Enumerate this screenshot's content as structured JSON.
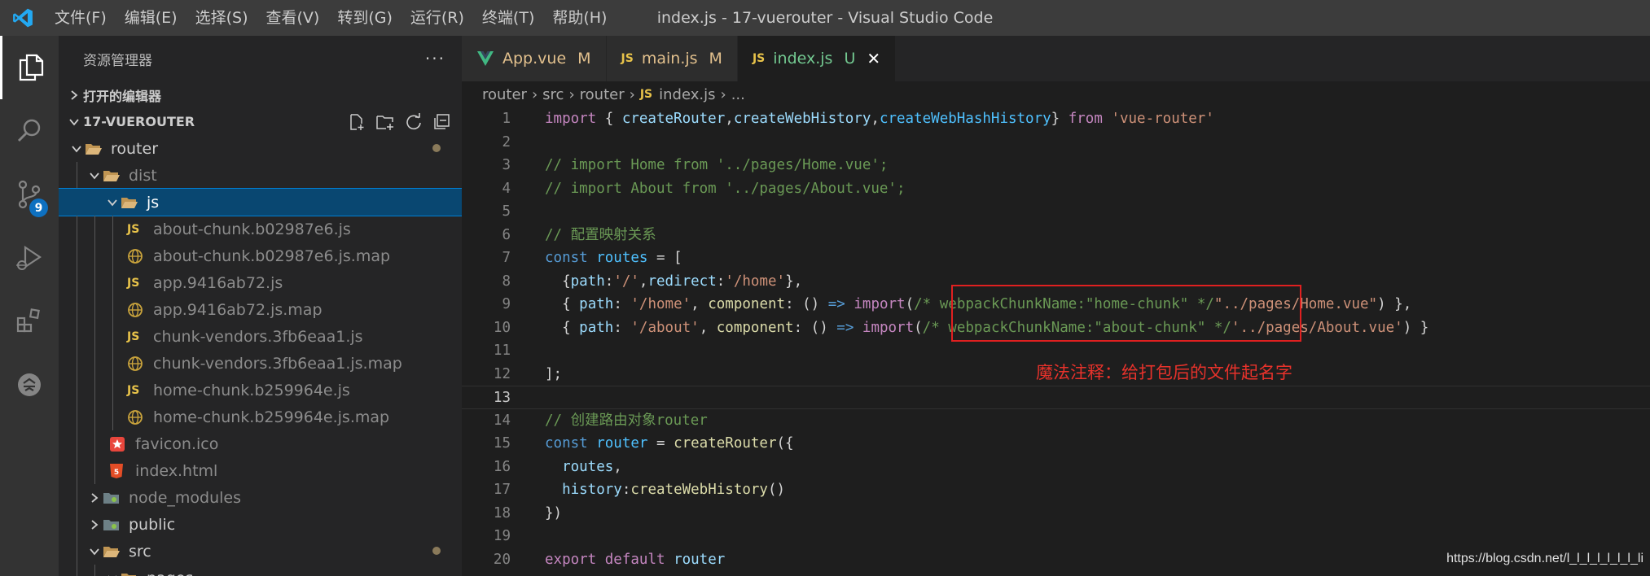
{
  "titlebar": {
    "menu": [
      "文件(F)",
      "编辑(E)",
      "选择(S)",
      "查看(V)",
      "转到(G)",
      "运行(R)",
      "终端(T)",
      "帮助(H)"
    ],
    "window_title": "index.js - 17-vuerouter - Visual Studio Code"
  },
  "activitybar": {
    "items": [
      {
        "icon": "explorer-icon"
      },
      {
        "icon": "search-icon"
      },
      {
        "icon": "source-control-icon",
        "badge": "9"
      },
      {
        "icon": "run-debug-icon"
      },
      {
        "icon": "extensions-icon"
      },
      {
        "icon": "remote-icon"
      }
    ]
  },
  "sidebar": {
    "title": "资源管理器",
    "more": "···",
    "open_editors": "打开的编辑器",
    "project": "17-VUEROUTER",
    "tree": [
      {
        "label": "router",
        "type": "folder-open",
        "depth": 0,
        "modified": true
      },
      {
        "label": "dist",
        "type": "folder-open",
        "depth": 1,
        "dim": true
      },
      {
        "label": "js",
        "type": "folder-open",
        "depth": 2,
        "selected": true
      },
      {
        "label": "about-chunk.b02987e6.js",
        "type": "js",
        "depth": 3,
        "dim": true
      },
      {
        "label": "about-chunk.b02987e6.js.map",
        "type": "map",
        "depth": 3,
        "dim": true
      },
      {
        "label": "app.9416ab72.js",
        "type": "js",
        "depth": 3,
        "dim": true
      },
      {
        "label": "app.9416ab72.js.map",
        "type": "map",
        "depth": 3,
        "dim": true
      },
      {
        "label": "chunk-vendors.3fb6eaa1.js",
        "type": "js",
        "depth": 3,
        "dim": true
      },
      {
        "label": "chunk-vendors.3fb6eaa1.js.map",
        "type": "map",
        "depth": 3,
        "dim": true
      },
      {
        "label": "home-chunk.b259964e.js",
        "type": "js",
        "depth": 3,
        "dim": true
      },
      {
        "label": "home-chunk.b259964e.js.map",
        "type": "map",
        "depth": 3,
        "dim": true
      },
      {
        "label": "favicon.ico",
        "type": "star",
        "depth": 2,
        "dim": true
      },
      {
        "label": "index.html",
        "type": "html",
        "depth": 2,
        "dim": true
      },
      {
        "label": "node_modules",
        "type": "folder-closed",
        "depth": 1,
        "dim": true
      },
      {
        "label": "public",
        "type": "folder-closed",
        "depth": 1
      },
      {
        "label": "src",
        "type": "folder-open",
        "depth": 1,
        "modified": true
      },
      {
        "label": "pages",
        "type": "folder-open",
        "depth": 2
      }
    ]
  },
  "tabs": [
    {
      "name": "App.vue",
      "icon": "vue",
      "status": "M",
      "status_color": "#e2c08d",
      "name_color": "#e2c08d"
    },
    {
      "name": "main.js",
      "icon": "js",
      "status": "M",
      "status_color": "#e2c08d",
      "name_color": "#e2c08d"
    },
    {
      "name": "index.js",
      "icon": "js",
      "status": "U",
      "status_color": "#73c991",
      "name_color": "#73c991",
      "active": true
    }
  ],
  "breadcrumb": {
    "parts": [
      "router",
      "src",
      "router"
    ],
    "file_icon": "JS",
    "file": "index.js",
    "tail": "..."
  },
  "editor": {
    "line_numbers": [
      "1",
      "2",
      "3",
      "4",
      "5",
      "6",
      "7",
      "8",
      "9",
      "10",
      "11",
      "12",
      "13",
      "14",
      "15",
      "16",
      "17",
      "18",
      "19",
      "20"
    ],
    "current_line": 13,
    "annotation": "魔法注释：给打包后的文件起名字"
  },
  "watermark": "https://blog.csdn.net/l_l_l_l_l_l_l_li",
  "colors": {
    "accent": "#007acc",
    "selection": "#094771",
    "annotation": "#e02020"
  }
}
